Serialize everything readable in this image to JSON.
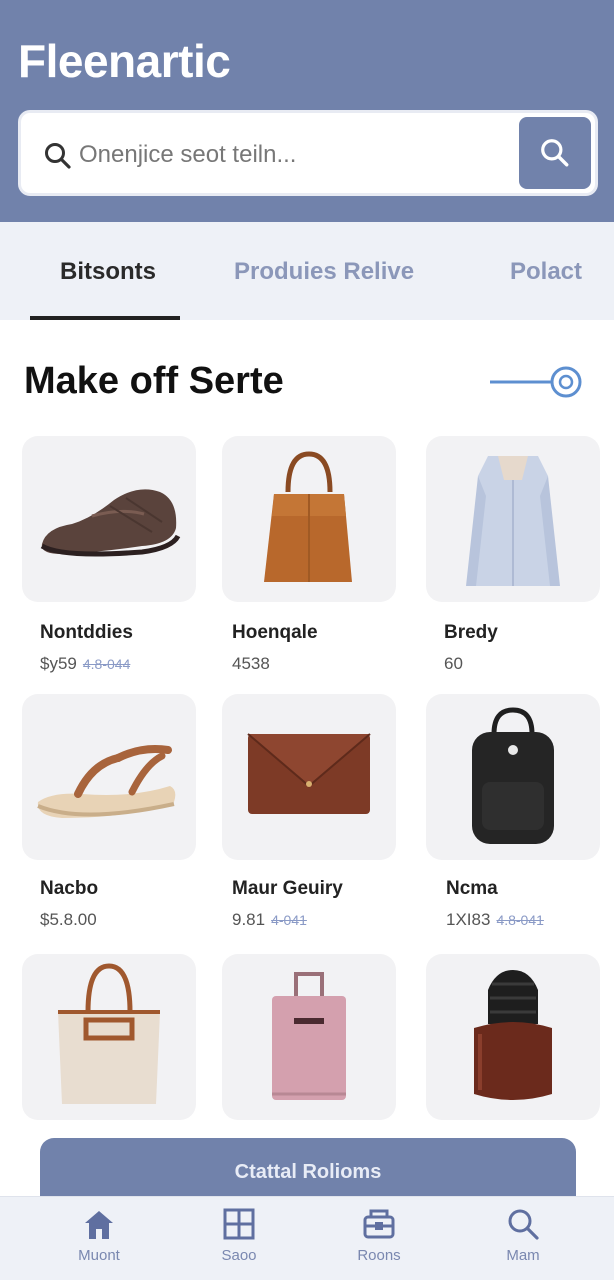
{
  "header": {
    "title": "Fleenartic",
    "search_placeholder": "Onenjice seot teiln...",
    "search_button_icon": "search-icon"
  },
  "tabs": [
    {
      "label": "Bitsonts",
      "active": true
    },
    {
      "label": "Produies Relive",
      "active": false
    },
    {
      "label": "Polact",
      "active": false
    }
  ],
  "section": {
    "title": "Make off Serte",
    "filter_icon": "slider-icon"
  },
  "products": [
    {
      "name": "Nontddies",
      "price": "$y59",
      "old_price": "4.8-044"
    },
    {
      "name": "Hoenqale",
      "price": "4538",
      "old_price": ""
    },
    {
      "name": "Bredy",
      "price": "60",
      "old_price": ""
    },
    {
      "name": "Nacbo",
      "price": "$5.8.00",
      "old_price": ""
    },
    {
      "name": "Maur Geuiry",
      "price": "9.81",
      "old_price": "4-041"
    },
    {
      "name": "Ncma",
      "price": "1XI83",
      "old_price": "4.8-041"
    },
    {
      "name": "",
      "price": "",
      "old_price": ""
    },
    {
      "name": "",
      "price": "",
      "old_price": ""
    },
    {
      "name": "",
      "price": "",
      "old_price": ""
    }
  ],
  "cta": {
    "label": "Ctattal Rolioms"
  },
  "bottom_nav": [
    {
      "label": "Muont",
      "icon": "home-icon"
    },
    {
      "label": "Saoo",
      "icon": "grid-icon"
    },
    {
      "label": "Roons",
      "icon": "inbox-icon"
    },
    {
      "label": "Mam",
      "icon": "search-icon"
    }
  ],
  "colors": {
    "primary": "#7182ab",
    "tab_bar_bg": "#eef1f7",
    "card_bg": "#f2f2f4"
  }
}
